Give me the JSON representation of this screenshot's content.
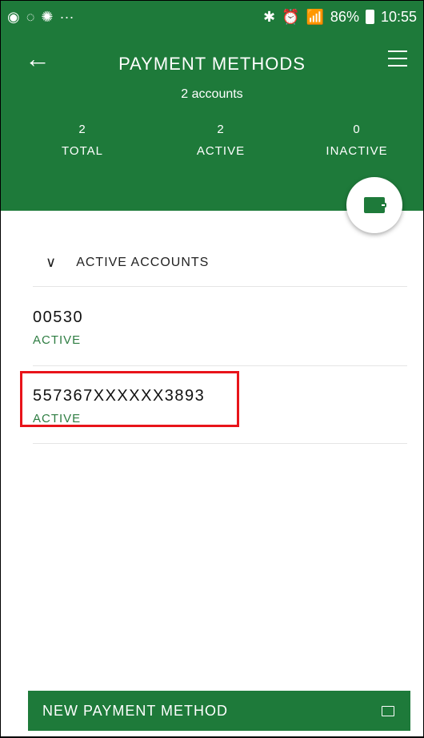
{
  "status_bar": {
    "left_icons": [
      "app-icon",
      "whatsapp-icon",
      "dots-icon"
    ],
    "overflow": "···",
    "battery": "86%",
    "time": "10:55"
  },
  "header": {
    "title": "PAYMENT METHODS",
    "subtitle": "2 accounts",
    "stats": [
      {
        "value": "2",
        "label": "TOTAL"
      },
      {
        "value": "2",
        "label": "ACTIVE"
      },
      {
        "value": "0",
        "label": "INACTIVE"
      }
    ]
  },
  "section": {
    "title": "ACTIVE ACCOUNTS"
  },
  "accounts": [
    {
      "number": "00530",
      "status": "ACTIVE"
    },
    {
      "number": "557367XXXXXX3893",
      "status": "ACTIVE"
    }
  ],
  "footer": {
    "new_button": "NEW PAYMENT METHOD"
  },
  "colors": {
    "primary": "#1e7a3a",
    "status_text": "#2e7d42",
    "highlight": "#e8141a"
  }
}
